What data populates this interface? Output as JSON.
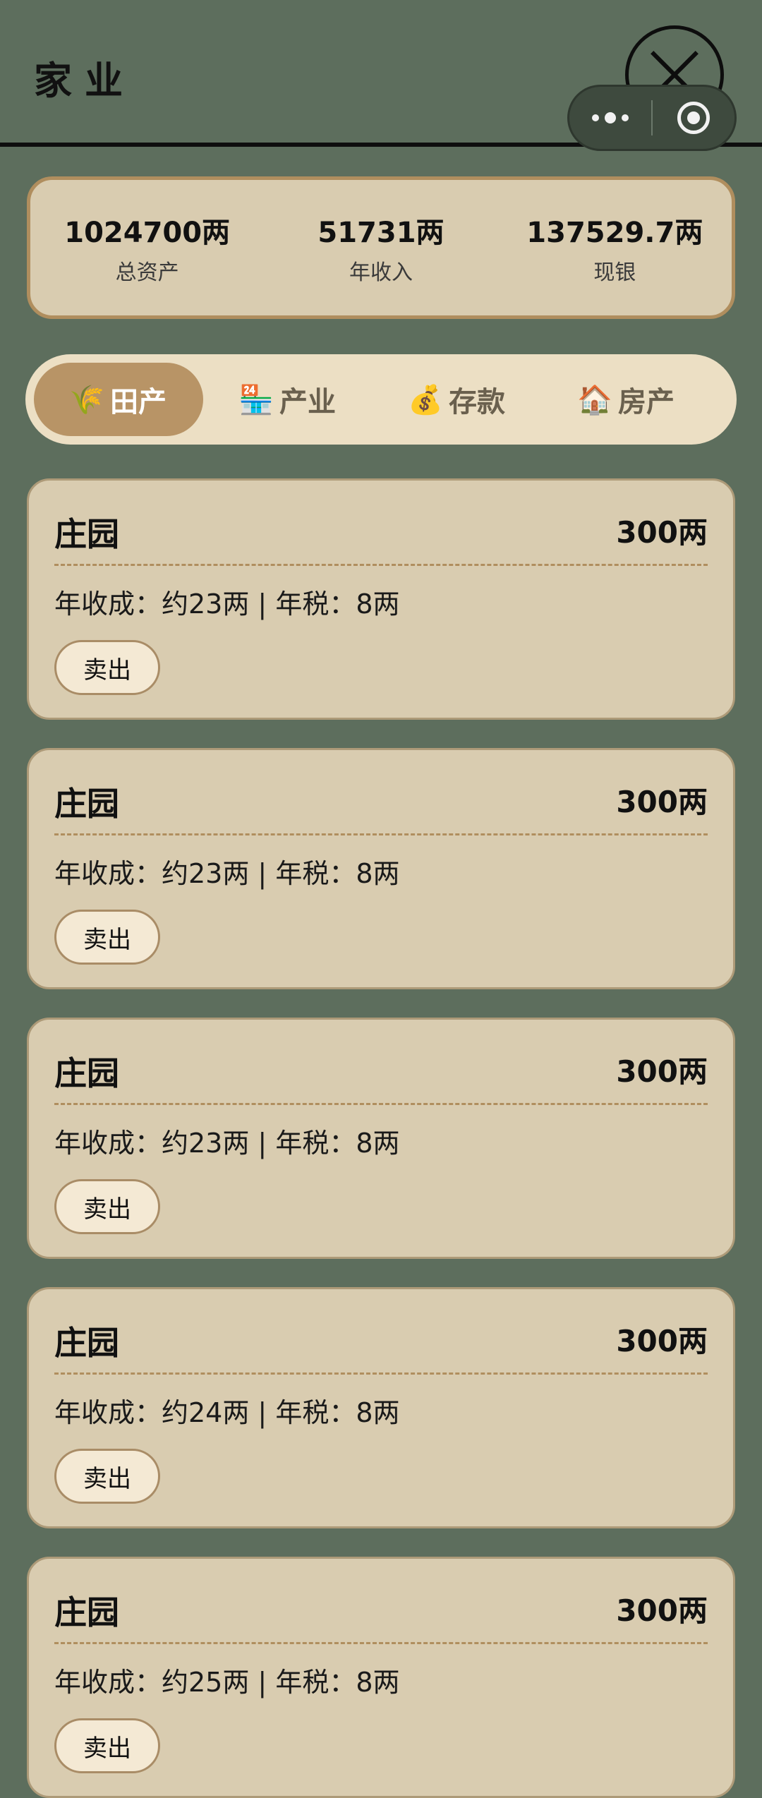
{
  "header": {
    "title": "家业"
  },
  "summary": [
    {
      "value": "1024700两",
      "label": "总资产"
    },
    {
      "value": "51731两",
      "label": "年收入"
    },
    {
      "value": "137529.7两",
      "label": "现银"
    }
  ],
  "tabs": [
    {
      "icon": "🌾",
      "label": "田产",
      "active": true
    },
    {
      "icon": "🏪",
      "label": "产业",
      "active": false
    },
    {
      "icon": "💰",
      "label": "存款",
      "active": false
    },
    {
      "icon": "🏠",
      "label": "房产",
      "active": false
    }
  ],
  "cards": [
    {
      "name": "庄园",
      "price": "300两",
      "info": "年收成：约23两 | 年税：8两",
      "button": "卖出"
    },
    {
      "name": "庄园",
      "price": "300两",
      "info": "年收成：约23两 | 年税：8两",
      "button": "卖出"
    },
    {
      "name": "庄园",
      "price": "300两",
      "info": "年收成：约23两 | 年税：8两",
      "button": "卖出"
    },
    {
      "name": "庄园",
      "price": "300两",
      "info": "年收成：约24两 | 年税：8两",
      "button": "卖出"
    },
    {
      "name": "庄园",
      "price": "300两",
      "info": "年收成：约25两 | 年税：8两",
      "button": "卖出"
    }
  ],
  "colors": {
    "background": "#5d6e5d",
    "card": "#d9ccb0",
    "accent": "#b89466",
    "border": "#b08e5e"
  }
}
